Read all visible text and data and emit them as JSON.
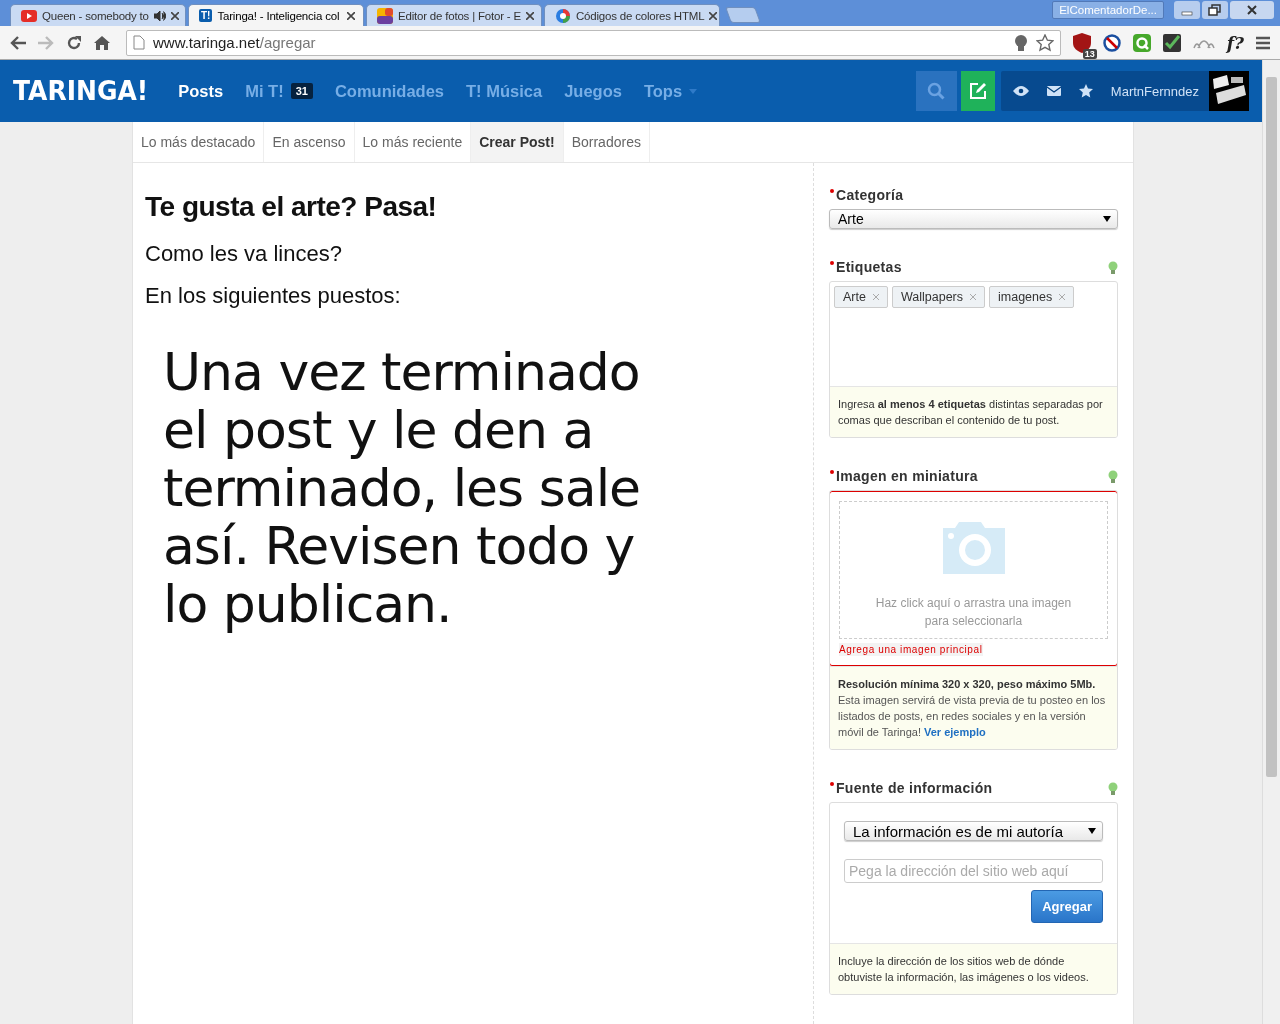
{
  "browser": {
    "tabs": [
      {
        "title": "Queen - somebody to",
        "audio": true,
        "selected": false
      },
      {
        "title": "Taringa! - Inteligencia col",
        "audio": false,
        "selected": true
      },
      {
        "title": "Editor de fotos | Fotor - E",
        "audio": false,
        "selected": false
      },
      {
        "title": "Códigos de colores HTML",
        "audio": false,
        "selected": false
      }
    ],
    "profile": "ElComentadorDe...",
    "address": {
      "host": "www.taringa.net",
      "path": "/agregar"
    },
    "extension_badge": "13",
    "extension_text": "f?",
    "taringa_icon_text": "T!"
  },
  "header": {
    "logo": "TARINGA!",
    "nav": [
      {
        "label": "Posts",
        "selected": true
      },
      {
        "label": "Mi T!",
        "selected": false,
        "badge": "31"
      },
      {
        "label": "Comunidades",
        "selected": false
      },
      {
        "label": "T! Música",
        "selected": false
      },
      {
        "label": "Juegos",
        "selected": false
      },
      {
        "label": "Tops",
        "selected": false,
        "dropdown": true
      }
    ],
    "username": "MartnFernndez"
  },
  "subnav": [
    {
      "label": "Lo más destacado",
      "selected": false
    },
    {
      "label": "En ascenso",
      "selected": false
    },
    {
      "label": "Lo más reciente",
      "selected": false
    },
    {
      "label": "Crear Post!",
      "selected": true
    },
    {
      "label": "Borradores",
      "selected": false
    }
  ],
  "post": {
    "title": "Te gusta el arte? Pasa!",
    "paragraphs": [
      "Como les va linces?",
      "En los siguientes puestos:"
    ],
    "large_text": "Una vez terminado el post y le den a terminado, les sale así. Revisen todo y lo publican."
  },
  "sidebar": {
    "category": {
      "label": "Categoría",
      "required": true,
      "value": "Arte"
    },
    "tags": {
      "label": "Etiquetas",
      "required": true,
      "hint": true,
      "items": [
        "Arte",
        "Wallpapers",
        "imagenes"
      ],
      "help": "Ingresa **al menos 4 etiquetas** distintas separadas por comas que describan el contenido de tu post."
    },
    "thumbnail": {
      "label": "Imagen en miniatura",
      "required": true,
      "hint": true,
      "error": true,
      "drop_text": "Haz click aquí o arrastra una imagen para seleccionarla",
      "error_text": "Agrega una imagen principal",
      "help_title": "Resolución mínima 320 x 320, peso máximo 5Mb.",
      "help": "Esta imagen servirá de vista previa de tu posteo en los listados de posts, en redes sociales y en la versión móvil de Taringa!",
      "help_link": "Ver ejemplo"
    },
    "source": {
      "label": "Fuente de información",
      "required": true,
      "hint": true,
      "select": "La información es de mi autoría",
      "url_placeholder": "Pega la dirección del sitio web aquí",
      "button": "Agregar",
      "help": "Incluye la dirección de los sitios web de dónde obtuviste la información, las imágenes o los videos."
    }
  }
}
